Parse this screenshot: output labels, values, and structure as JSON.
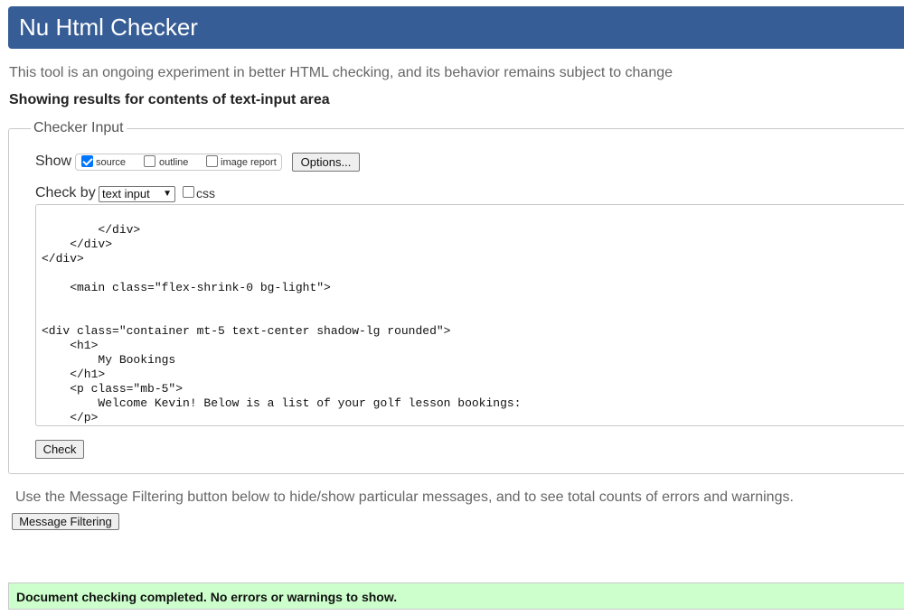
{
  "header": {
    "title": "Nu Html Checker"
  },
  "intro_text": "This tool is an ongoing experiment in better HTML checking, and its behavior remains subject to change",
  "results_heading": "Showing results for contents of text-input area",
  "checker_input": {
    "legend": "Checker Input",
    "show_label": "Show",
    "show_options": [
      {
        "label": "source",
        "checked": true
      },
      {
        "label": "outline",
        "checked": false
      },
      {
        "label": "image report",
        "checked": false
      }
    ],
    "options_button": "Options...",
    "check_by_label": "Check by",
    "check_by_value": "text input",
    "css_label": "css",
    "css_checked": false,
    "source_lines": [
      "        </div>",
      "    </div>",
      "</div>",
      "",
      "    <main class=\"flex-shrink-0 bg-light\">",
      "",
      "",
      "<div class=\"container mt-5 text-center shadow-lg rounded\">",
      "    <h1>",
      "        My Bookings",
      "    </h1>",
      "    <p class=\"mb-5\">",
      "        Welcome Kevin! Below is a list of your golf lesson bookings:",
      "    </p>"
    ],
    "check_button": "Check"
  },
  "filter_note": "Use the Message Filtering button below to hide/show particular messages, and to see total counts of errors and warnings.",
  "filter_button": "Message Filtering",
  "success_message": "Document checking completed. No errors or warnings to show.",
  "colors": {
    "header_bg": "#365d95",
    "success_bg": "#ccffcc",
    "checkbox_checked": "#0075ff"
  }
}
